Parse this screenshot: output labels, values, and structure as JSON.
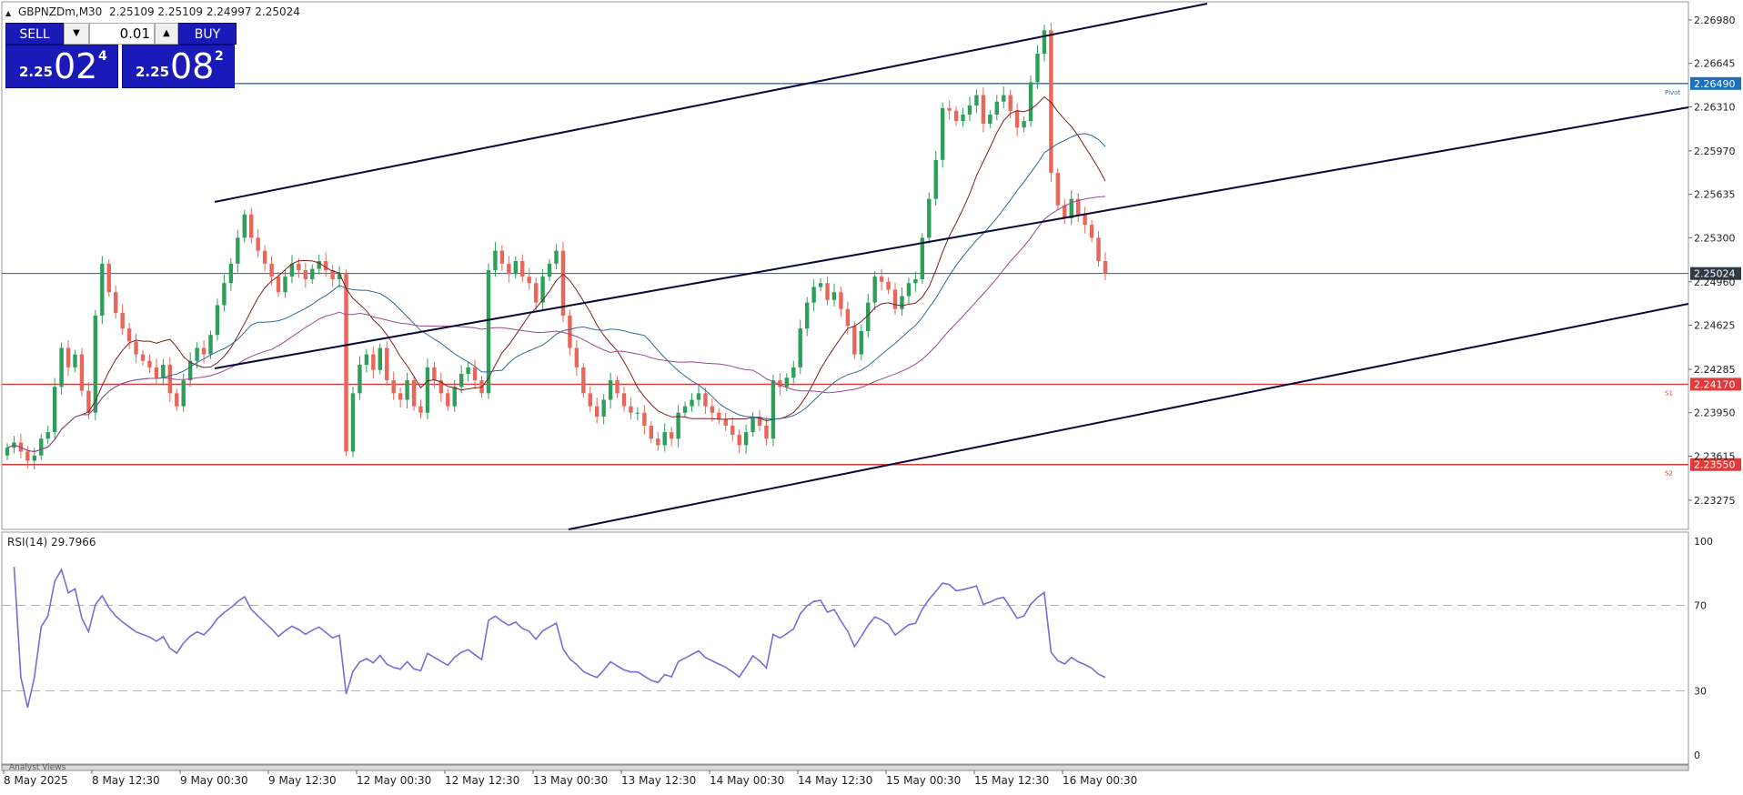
{
  "chart_header": {
    "symbol_timeframe": "GBPNZDm,M30",
    "ohlc": "2.25109 2.25109 2.24997 2.25024"
  },
  "trade_panel": {
    "sell_label": "SELL",
    "buy_label": "BUY",
    "lot_size": "0.01",
    "sell_price": {
      "prefix": "2.25",
      "big": "02",
      "sup": "4"
    },
    "buy_price": {
      "prefix": "2.25",
      "big": "08",
      "sup": "2"
    }
  },
  "price_axis": {
    "ticks": [
      "2.26980",
      "2.26645",
      "2.26310",
      "2.25970",
      "2.25635",
      "2.25300",
      "2.24960",
      "2.24625",
      "2.24285",
      "2.23950",
      "2.23615",
      "2.23275"
    ],
    "tick_values": [
      2.2698,
      2.26645,
      2.2631,
      2.2597,
      2.25635,
      2.253,
      2.2496,
      2.24625,
      2.24285,
      2.2395,
      2.23615,
      2.23275
    ],
    "price_min": 2.2305,
    "price_max": 2.2712
  },
  "levels": [
    {
      "name": "pivot",
      "price": 2.2649,
      "label": "2.26490",
      "tag": "Pivot",
      "color": "#1f6fbf"
    },
    {
      "name": "s1",
      "price": 2.2417,
      "label": "2.24170",
      "tag": "S1",
      "color": "#e03a3a"
    },
    {
      "name": "s2",
      "price": 2.2355,
      "label": "2.23550",
      "tag": "S2",
      "color": "#e03a3a"
    },
    {
      "name": "bid",
      "price": 2.25024,
      "label": "2.25024",
      "tag": "",
      "color": "#2e3a46"
    }
  ],
  "rsi": {
    "title": "RSI(14) 29.7966",
    "scale_labels": [
      "100",
      "70",
      "30",
      "0"
    ],
    "scale_values": [
      100,
      70,
      30,
      0
    ],
    "levels": [
      70,
      30
    ],
    "color": "#7b6bd6"
  },
  "time_axis": {
    "labels": [
      "8 May 2025",
      "8 May 12:30",
      "9 May 00:30",
      "9 May 12:30",
      "12 May 00:30",
      "12 May 12:30",
      "13 May 00:30",
      "13 May 12:30",
      "14 May 00:30",
      "14 May 12:30",
      "15 May 00:30",
      "15 May 12:30",
      "16 May 00:30"
    ]
  },
  "bottom_tab": "Analyst Views",
  "colors": {
    "bull": "#2e9e5b",
    "bear": "#e8665a",
    "channel": "#0a0a3a",
    "ma_fast": "#7a1f1f",
    "ma_mid": "#2f6a8f",
    "ma_slow": "#9a4a8a"
  },
  "chart_data": {
    "type": "candlestick",
    "symbol": "GBPNZDm",
    "timeframe": "M30",
    "close": [
      2.2368,
      2.2372,
      2.2365,
      2.2358,
      2.2362,
      2.2375,
      2.238,
      2.2415,
      2.2445,
      2.243,
      2.244,
      2.2412,
      2.2395,
      2.247,
      2.251,
      2.2488,
      2.2472,
      2.246,
      2.245,
      2.244,
      2.2435,
      2.243,
      2.2422,
      2.2432,
      2.241,
      2.24,
      2.242,
      2.2435,
      2.2445,
      2.244,
      2.2455,
      2.2478,
      2.2495,
      2.251,
      2.253,
      2.2548,
      2.253,
      2.252,
      2.251,
      2.25,
      2.2488,
      2.25,
      2.251,
      2.2505,
      2.2498,
      2.2506,
      2.2512,
      2.2505,
      2.2498,
      2.2502,
      2.2365,
      2.241,
      2.2432,
      2.244,
      2.2428,
      2.2445,
      2.242,
      2.241,
      2.2405,
      2.242,
      2.24,
      2.2395,
      2.243,
      2.242,
      2.241,
      2.24,
      2.2415,
      2.2425,
      2.243,
      2.242,
      2.241,
      2.2505,
      2.252,
      2.251,
      2.2502,
      2.2512,
      2.25,
      2.2495,
      2.248,
      2.25,
      2.251,
      2.252,
      2.247,
      2.2445,
      2.243,
      2.241,
      2.24,
      2.2392,
      2.2405,
      2.242,
      2.241,
      2.24,
      2.2395,
      2.2395,
      2.2385,
      2.2375,
      2.237,
      2.238,
      2.2375,
      2.2395,
      2.24,
      2.2405,
      2.241,
      2.24,
      2.2395,
      2.239,
      2.2385,
      2.2378,
      2.237,
      2.238,
      2.2392,
      2.2385,
      2.2375,
      2.242,
      2.2415,
      2.2422,
      2.243,
      2.246,
      2.248,
      2.2492,
      2.2495,
      2.2482,
      2.2488,
      2.2475,
      2.2462,
      2.244,
      2.2458,
      2.248,
      2.25,
      2.2496,
      2.249,
      2.2475,
      2.2485,
      2.2495,
      2.2498,
      2.253,
      2.256,
      2.259,
      2.263,
      2.2628,
      2.262,
      2.2625,
      2.2632,
      2.264,
      2.2618,
      2.2625,
      2.2635,
      2.264,
      2.2628,
      2.2615,
      2.262,
      2.265,
      2.2672,
      2.269,
      2.258,
      2.2555,
      2.2545,
      2.256,
      2.2548,
      2.254,
      2.253,
      2.2512,
      2.25024
    ],
    "ylim": [
      2.2305,
      2.2712
    ]
  }
}
